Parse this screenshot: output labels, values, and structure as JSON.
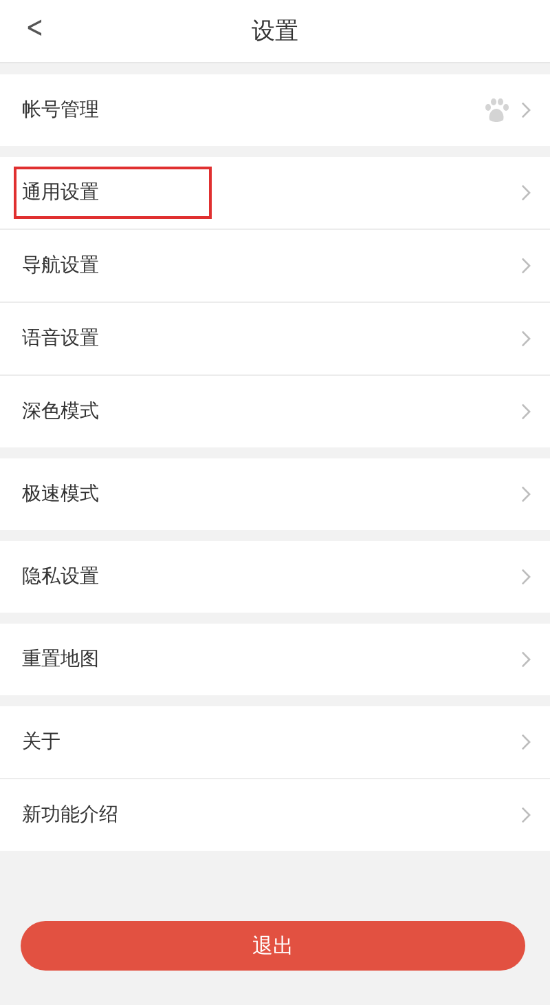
{
  "header": {
    "back": "<",
    "title": "设置"
  },
  "groups": [
    {
      "items": [
        {
          "label": "帐号管理",
          "kind": "account",
          "highlighted": false
        }
      ]
    },
    {
      "items": [
        {
          "label": "通用设置",
          "kind": "plain",
          "highlighted": true
        },
        {
          "label": "导航设置",
          "kind": "plain",
          "highlighted": false
        },
        {
          "label": "语音设置",
          "kind": "plain",
          "highlighted": false
        },
        {
          "label": "深色模式",
          "kind": "plain",
          "highlighted": false
        }
      ]
    },
    {
      "items": [
        {
          "label": "极速模式",
          "kind": "plain",
          "highlighted": false
        }
      ]
    },
    {
      "items": [
        {
          "label": "隐私设置",
          "kind": "plain",
          "highlighted": false
        }
      ]
    },
    {
      "items": [
        {
          "label": "重置地图",
          "kind": "plain",
          "highlighted": false
        }
      ]
    },
    {
      "items": [
        {
          "label": "关于",
          "kind": "plain",
          "highlighted": false
        },
        {
          "label": "新功能介绍",
          "kind": "plain",
          "highlighted": false
        }
      ]
    }
  ],
  "logout_button": "退出"
}
